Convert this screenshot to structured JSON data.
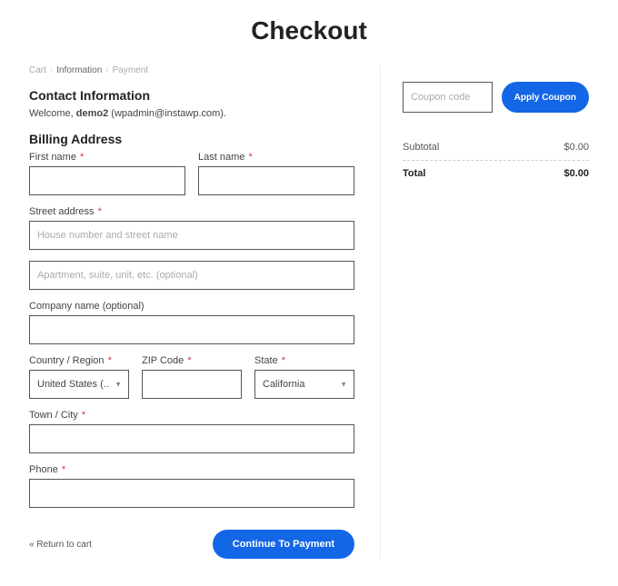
{
  "title": "Checkout",
  "breadcrumbs": {
    "cart": "Cart",
    "info": "Information",
    "payment": "Payment"
  },
  "contact": {
    "heading": "Contact Information",
    "welcome_prefix": "Welcome, ",
    "welcome_name": "demo2",
    "welcome_suffix": " (wpadmin@instawp.com)."
  },
  "billing": {
    "heading": "Billing Address",
    "first_name_label": "First name",
    "last_name_label": "Last name",
    "street_label": "Street address",
    "street1_placeholder": "House number and street name",
    "street2_placeholder": "Apartment, suite, unit, etc. (optional)",
    "company_label": "Company name (optional)",
    "country_label": "Country / Region",
    "country_value": "United States (...",
    "zip_label": "ZIP Code",
    "state_label": "State",
    "state_value": "California",
    "city_label": "Town / City",
    "phone_label": "Phone"
  },
  "actions": {
    "return": "« Return to cart",
    "continue": "Continue To Payment"
  },
  "coupon": {
    "placeholder": "Coupon code",
    "button": "Apply Coupon"
  },
  "summary": {
    "subtotal_label": "Subtotal",
    "subtotal_value": "$0.00",
    "total_label": "Total",
    "total_value": "$0.00"
  },
  "asterisk": "*"
}
